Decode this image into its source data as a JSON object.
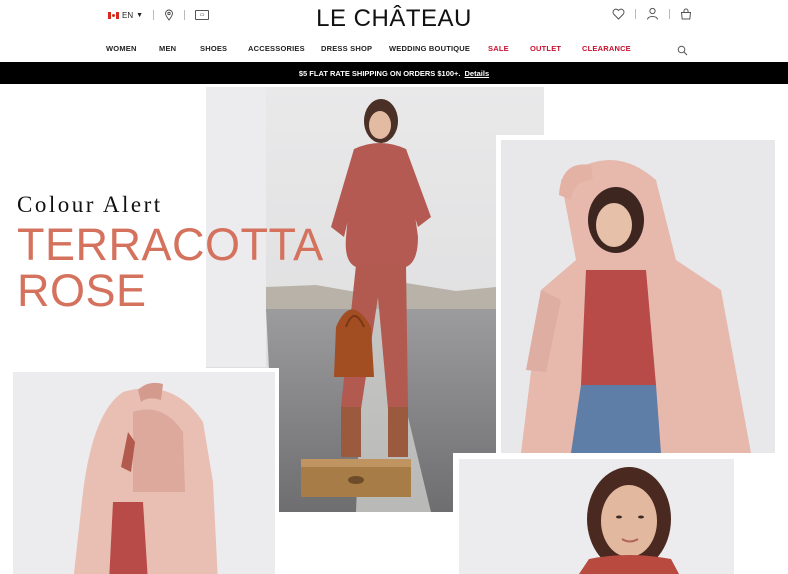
{
  "header": {
    "language": "EN",
    "logo": "LE CHÂTEAU"
  },
  "nav": {
    "items": [
      {
        "label": "WOMEN",
        "style": "normal"
      },
      {
        "label": "MEN",
        "style": "normal"
      },
      {
        "label": "SHOES",
        "style": "normal"
      },
      {
        "label": "ACCESSORIES",
        "style": "normal"
      },
      {
        "label": "DRESS SHOP",
        "style": "normal"
      },
      {
        "label": "WEDDING BOUTIQUE",
        "style": "normal"
      },
      {
        "label": "SALE",
        "style": "red"
      },
      {
        "label": "OUTLET",
        "style": "red"
      },
      {
        "label": "CLEARANCE",
        "style": "red"
      }
    ]
  },
  "promo": {
    "text": "$5 FLAT RATE SHIPPING ON ORDERS $100+.",
    "link": "Details"
  },
  "hero": {
    "kicker": "Colour Alert",
    "title_line1": "TERRACOTTA",
    "title_line2": "ROSE"
  },
  "colors": {
    "accent": "#d4725e",
    "sale_red": "#c8102e",
    "promo_bg": "#000000"
  },
  "icons": [
    "canada-flag-icon",
    "chevron-down-icon",
    "location-pin-icon",
    "gift-card-icon",
    "heart-icon",
    "user-icon",
    "shopping-bag-icon",
    "search-icon"
  ]
}
